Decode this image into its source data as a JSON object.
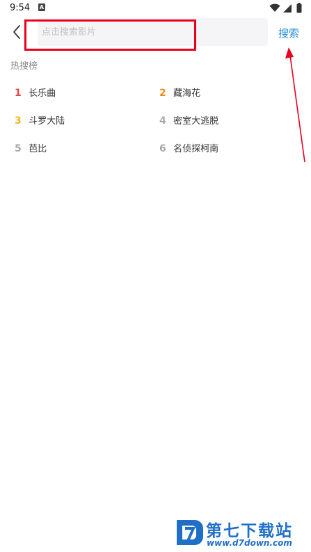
{
  "status_bar": {
    "time": "9:54",
    "notification_icon": "a-icon",
    "wifi_icon": "wifi-icon",
    "signal_icon": "signal-icon",
    "battery_icon": "battery-icon"
  },
  "header": {
    "back_icon": "chevron-left-icon",
    "search_placeholder": "点击搜索影片",
    "search_button": "搜索",
    "accent_color": "#1e8bd6",
    "highlight_color": "#e8001c"
  },
  "hot_search": {
    "title": "热搜榜",
    "items": [
      {
        "rank": "1",
        "label": "长乐曲",
        "color": "#e5483f"
      },
      {
        "rank": "2",
        "label": "藏海花",
        "color": "#f08c1a"
      },
      {
        "rank": "3",
        "label": "斗罗大陆",
        "color": "#f2b51f"
      },
      {
        "rank": "4",
        "label": "密室大逃脱",
        "color": "#a8a8a8"
      },
      {
        "rank": "5",
        "label": "芭比",
        "color": "#a8a8a8"
      },
      {
        "rank": "6",
        "label": "名侦探柯南",
        "color": "#a8a8a8"
      }
    ]
  },
  "watermark": {
    "title": "第七下载站",
    "url": "www.d7down.com"
  }
}
